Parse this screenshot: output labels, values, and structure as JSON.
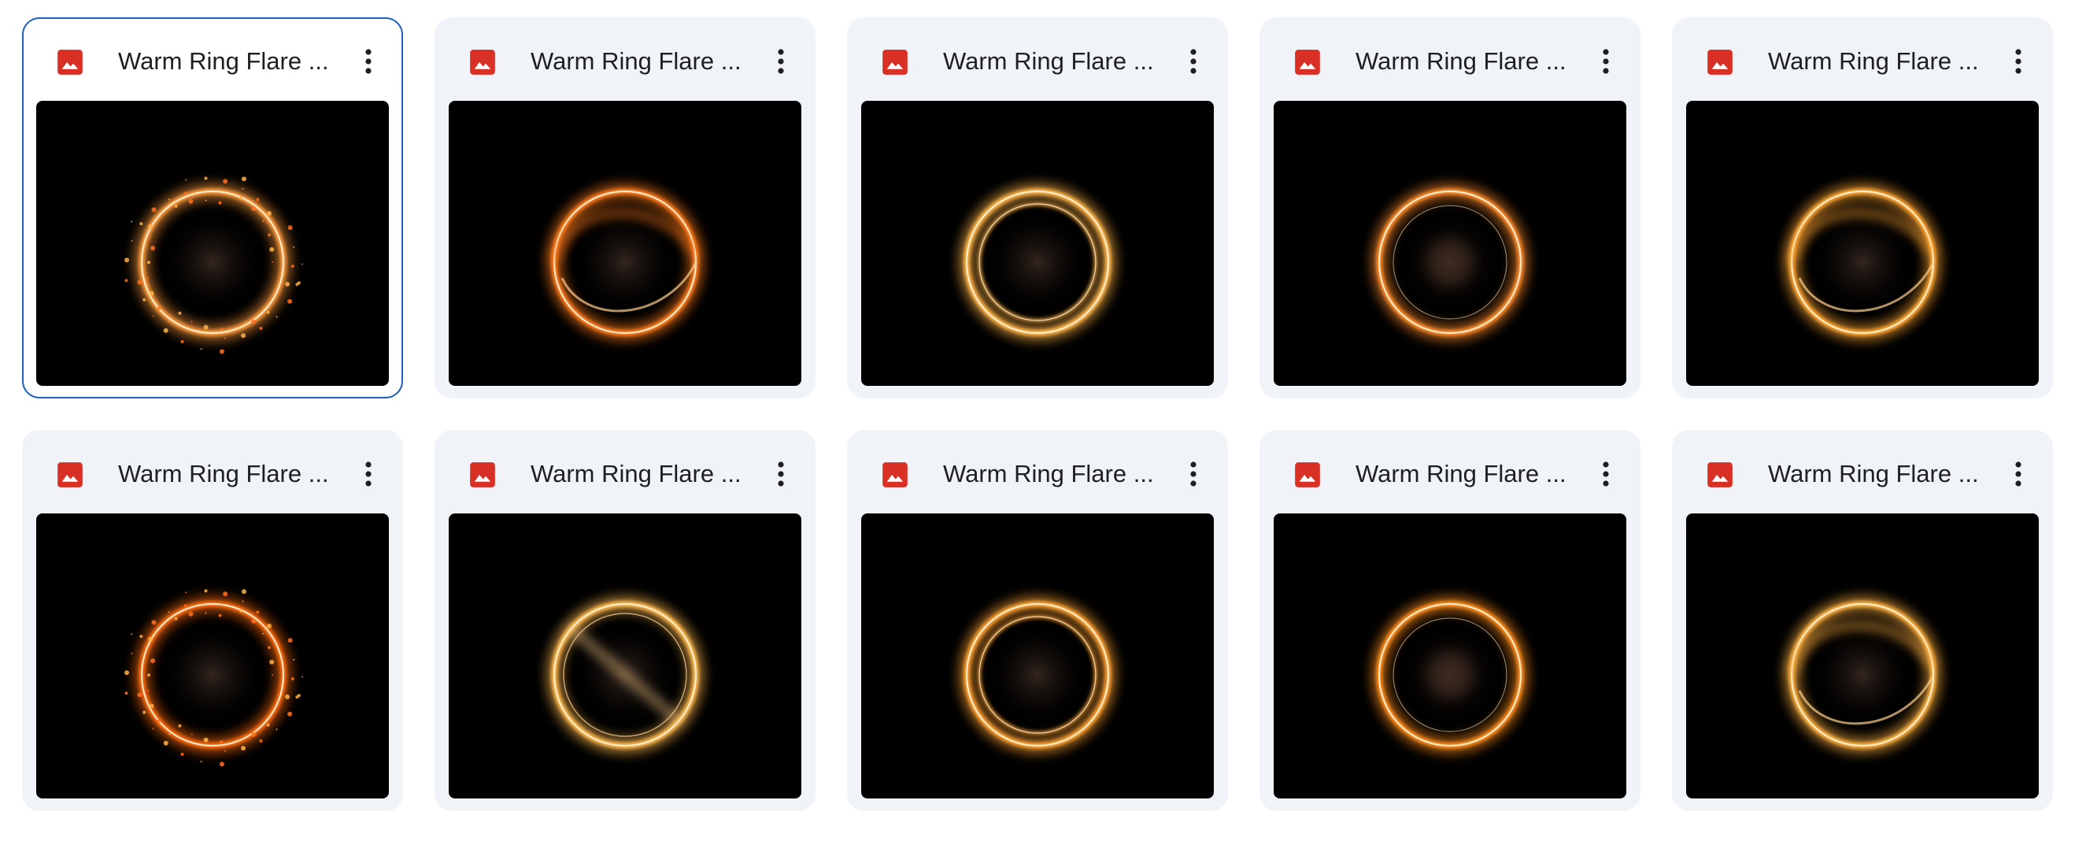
{
  "colors": {
    "card_bg": "#f0f4f9",
    "selected_border": "#1b5fbf",
    "image_icon": "#d93025",
    "thumbnail_bg": "#000000"
  },
  "files": [
    {
      "name": "Warm Ring Flare ...",
      "icon": "image-icon",
      "selected": true,
      "ring": {
        "hue": "#ff9a3a",
        "style": "sparks"
      }
    },
    {
      "name": "Warm Ring Flare ...",
      "icon": "image-icon",
      "selected": false,
      "ring": {
        "hue": "#ff7a1a",
        "style": "swirl"
      }
    },
    {
      "name": "Warm Ring Flare ...",
      "icon": "image-icon",
      "selected": false,
      "ring": {
        "hue": "#ffb347",
        "style": "double"
      }
    },
    {
      "name": "Warm Ring Flare ...",
      "icon": "image-icon",
      "selected": false,
      "ring": {
        "hue": "#ff8a2a",
        "style": "glow"
      }
    },
    {
      "name": "Warm Ring Flare ...",
      "icon": "image-icon",
      "selected": false,
      "ring": {
        "hue": "#ffa533",
        "style": "swirl"
      }
    },
    {
      "name": "Warm Ring Flare ...",
      "icon": "image-icon",
      "selected": false,
      "ring": {
        "hue": "#ff6a10",
        "style": "sparks"
      }
    },
    {
      "name": "Warm Ring Flare ...",
      "icon": "image-icon",
      "selected": false,
      "ring": {
        "hue": "#ffb84d",
        "style": "streak"
      }
    },
    {
      "name": "Warm Ring Flare ...",
      "icon": "image-icon",
      "selected": false,
      "ring": {
        "hue": "#ffa030",
        "style": "double"
      }
    },
    {
      "name": "Warm Ring Flare ...",
      "icon": "image-icon",
      "selected": false,
      "ring": {
        "hue": "#ff8c1a",
        "style": "glow"
      }
    },
    {
      "name": "Warm Ring Flare ...",
      "icon": "image-icon",
      "selected": false,
      "ring": {
        "hue": "#ffb040",
        "style": "swirl"
      }
    }
  ]
}
